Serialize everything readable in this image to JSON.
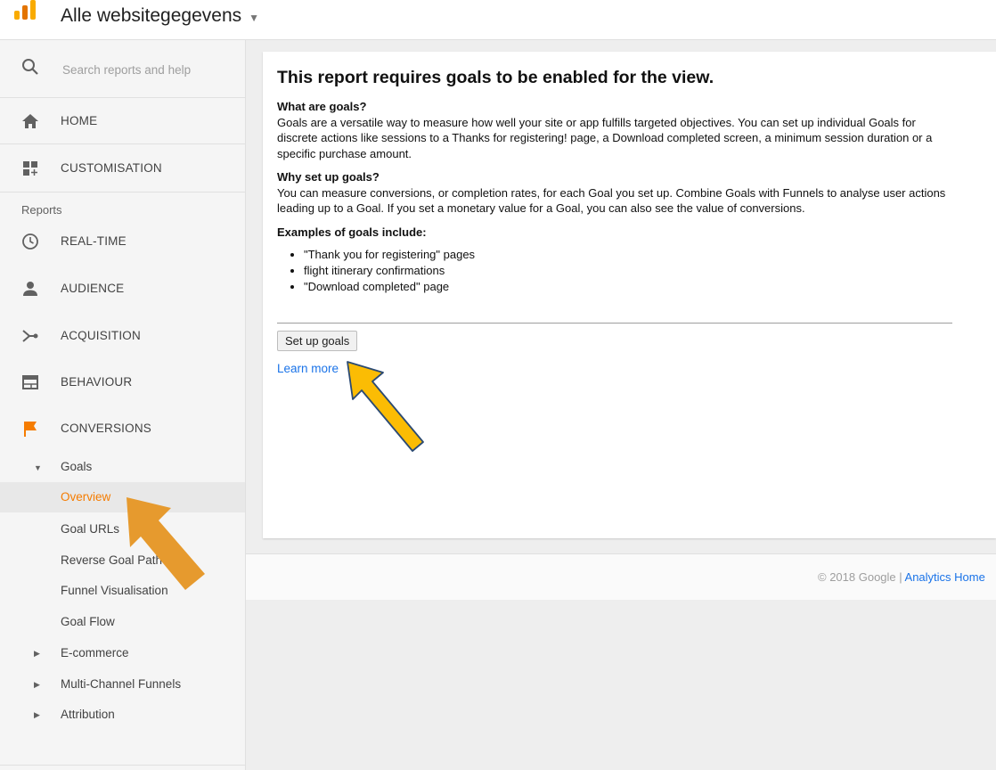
{
  "header": {
    "property_name": "Alle websitegegevens"
  },
  "sidebar": {
    "search": {
      "placeholder": "Search reports and help"
    },
    "top_items": [
      {
        "label": "HOME",
        "icon": "home-icon"
      },
      {
        "label": "CUSTOMISATION",
        "icon": "dashboard-icon"
      }
    ],
    "section_label": "Reports",
    "report_items": [
      {
        "label": "REAL-TIME",
        "icon": "clock-icon"
      },
      {
        "label": "AUDIENCE",
        "icon": "person-icon"
      },
      {
        "label": "ACQUISITION",
        "icon": "acquisition-icon"
      },
      {
        "label": "BEHAVIOUR",
        "icon": "window-icon"
      },
      {
        "label": "CONVERSIONS",
        "icon": "flag-icon"
      }
    ],
    "goals": {
      "label": "Goals",
      "items": [
        {
          "label": "Overview",
          "active": true
        },
        {
          "label": "Goal URLs"
        },
        {
          "label": "Reverse Goal Path"
        },
        {
          "label": "Funnel Visualisation"
        },
        {
          "label": "Goal Flow"
        }
      ]
    },
    "collapsed_items": [
      {
        "label": "E-commerce"
      },
      {
        "label": "Multi-Channel Funnels"
      },
      {
        "label": "Attribution"
      }
    ]
  },
  "main": {
    "title": "This report requires goals to be enabled for the view.",
    "what_heading": "What are goals?",
    "what_text": "Goals are a versatile way to measure how well your site or app fulfills targeted objectives. You can set up individual Goals for discrete actions like sessions to a Thanks for registering! page, a Download completed screen, a minimum session duration or a specific purchase amount.",
    "why_heading": "Why set up goals?",
    "why_text": "You can measure conversions, or completion rates, for each Goal you set up. Combine Goals with Funnels to analyse user actions leading up to a Goal. If you set a monetary value for a Goal, you can also see the value of conversions.",
    "examples_heading": "Examples of goals include:",
    "examples": [
      "\"Thank you for registering\" pages",
      "flight itinerary confirmations",
      "\"Download completed\" page"
    ],
    "setup_button": "Set up goals",
    "learn_more": "Learn more"
  },
  "footer": {
    "copyright": "© 2018 Google | ",
    "link": "Analytics Home"
  },
  "colors": {
    "accent_orange": "#f57c00",
    "link_blue": "#1a73e8",
    "arrow_gold": "#fbbc04",
    "arrow_orange": "#e69a2e"
  }
}
